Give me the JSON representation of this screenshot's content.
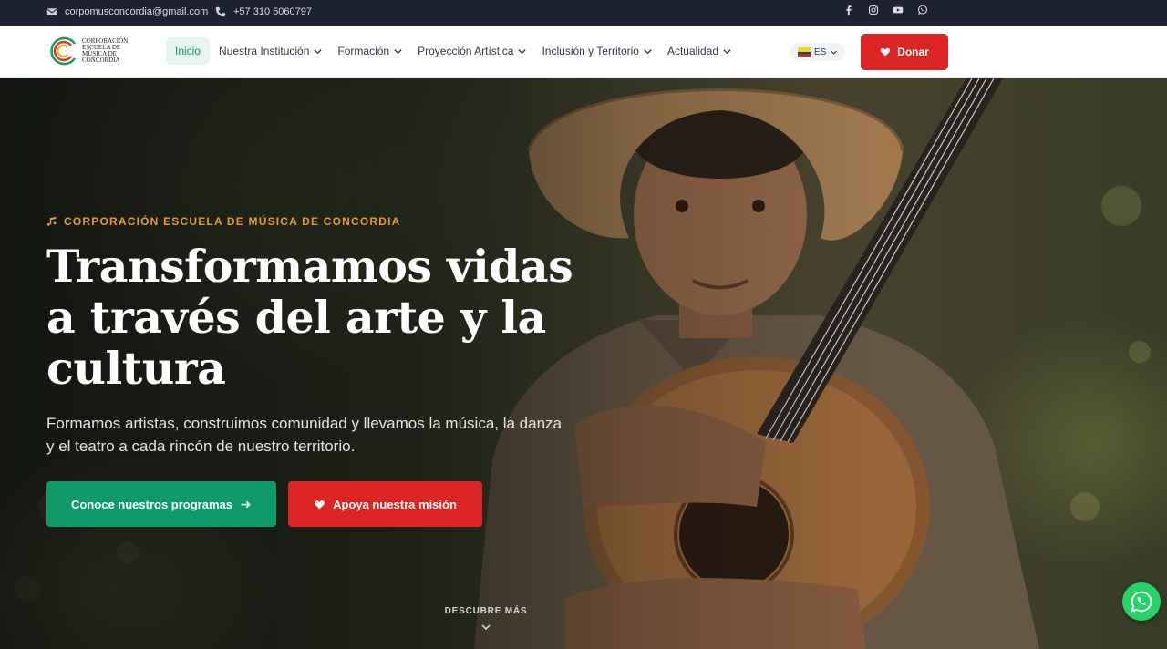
{
  "topbar": {
    "email": "corpomusconcordia@gmail.com",
    "phone": "+57 310 5060797",
    "socials": [
      "facebook-icon",
      "instagram-icon",
      "youtube-icon",
      "whatsapp-icon"
    ]
  },
  "logo": {
    "text": "CORPORACIÓN ESCUELA DE MÚSICA DE CONCORDIA"
  },
  "nav": {
    "items": [
      {
        "label": "Inicio",
        "active": true,
        "dropdown": false
      },
      {
        "label": "Nuestra Institución",
        "dropdown": true
      },
      {
        "label": "Formación",
        "dropdown": true
      },
      {
        "label": "Proyección Artística",
        "dropdown": true
      },
      {
        "label": "Inclusión y Territorio",
        "dropdown": true
      },
      {
        "label": "Actualidad",
        "dropdown": true
      }
    ],
    "language": "ES",
    "donate_label": "Donar"
  },
  "hero": {
    "eyebrow": "CORPORACIÓN ESCUELA DE MÚSICA DE CONCORDIA",
    "headline": "Transformamos vidas a través del arte y la cultura",
    "subtitle": "Formamos artistas, construimos comunidad y llevamos la música, la danza y el teatro a cada rincón de nuestro territorio.",
    "primary_cta": "Conoce nuestros programas",
    "secondary_cta": "Apoya nuestra misión",
    "discover": "DESCUBRE MÁS"
  },
  "colors": {
    "topbar_bg": "#1c2230",
    "accent_green": "#0f9a6a",
    "accent_red": "#dc2626",
    "eyebrow_orange": "#e59a2b"
  }
}
